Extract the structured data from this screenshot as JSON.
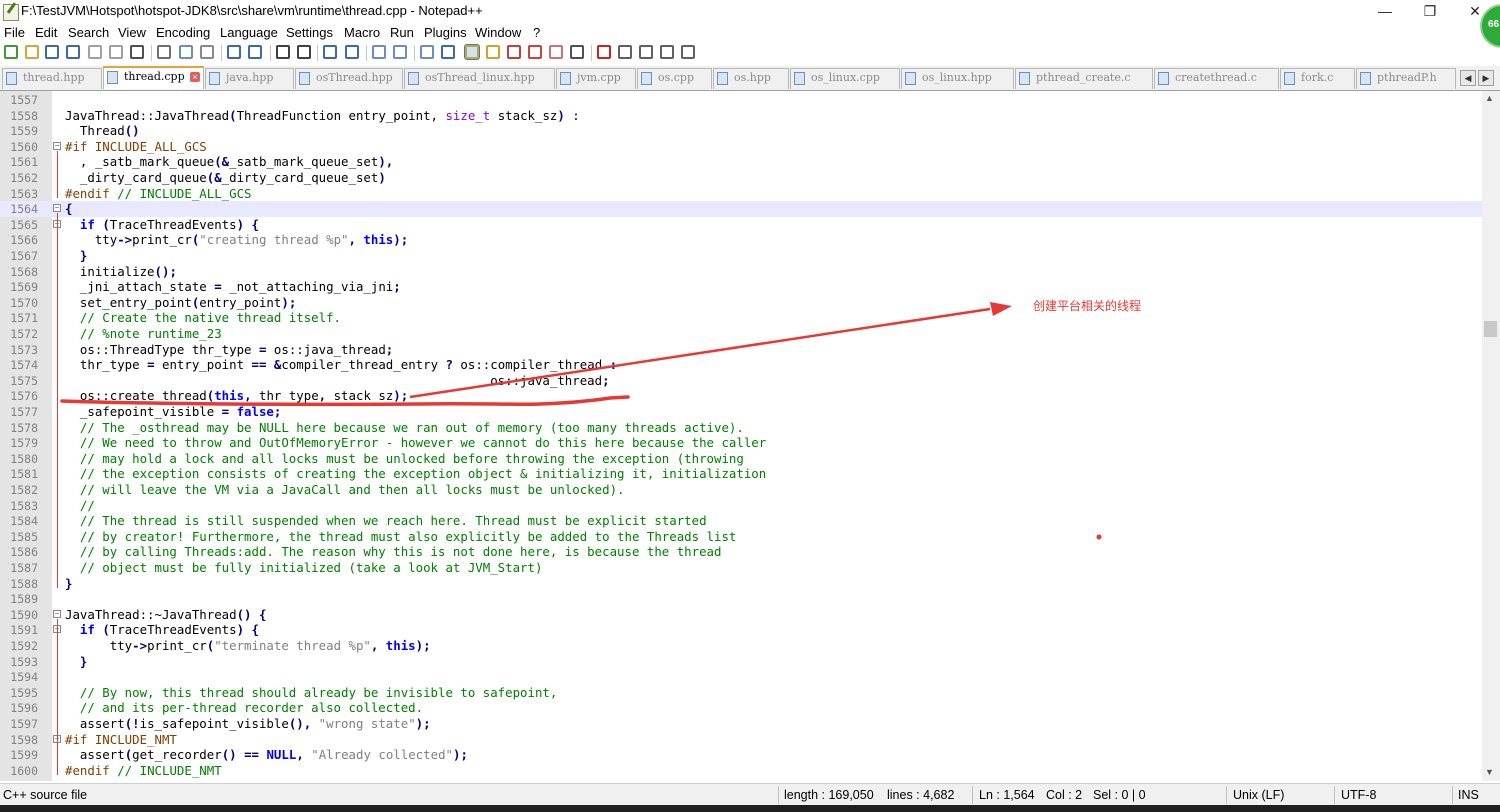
{
  "window": {
    "title": "F:\\TestJVM\\Hotspot\\hotspot-JDK8\\src\\share\\vm\\runtime\\thread.cpp - Notepad++",
    "badge": "66",
    "controls": {
      "minimize": "—",
      "maximize": "❐",
      "close": "✕"
    }
  },
  "menu": [
    "File",
    "Edit",
    "Search",
    "View",
    "Encoding",
    "Language",
    "Settings",
    "Macro",
    "Run",
    "Plugins",
    "Window",
    "?"
  ],
  "toolbar_icons": [
    "new-file-icon",
    "open-file-icon",
    "save-icon",
    "save-all-icon",
    "close-icon",
    "close-all-icon",
    "print-icon",
    "cut-icon",
    "copy-icon",
    "paste-icon",
    "undo-icon",
    "redo-icon",
    "find-icon",
    "replace-icon",
    "zoom-in-icon",
    "zoom-out-icon",
    "sync-v-icon",
    "sync-h-icon",
    "wrap-icon",
    "show-all-chars-icon",
    "indent-guide-icon",
    "udl-icon",
    "doc-map-icon",
    "function-list-icon",
    "folder-workspace-icon",
    "monitor-icon",
    "record-macro-icon",
    "stop-record-icon",
    "play-macro-icon",
    "run-macro-multiple-icon",
    "save-macro-icon"
  ],
  "tabs": [
    {
      "label": "thread.hpp"
    },
    {
      "label": "thread.cpp"
    },
    {
      "label": "java.hpp"
    },
    {
      "label": "osThread.hpp"
    },
    {
      "label": "osThread_linux.hpp"
    },
    {
      "label": "jvm.cpp"
    },
    {
      "label": "os.cpp"
    },
    {
      "label": "os.hpp"
    },
    {
      "label": "os_linux.cpp"
    },
    {
      "label": "os_linux.hpp"
    },
    {
      "label": "pthread_create.c"
    },
    {
      "label": "createthread.c"
    },
    {
      "label": "fork.c"
    },
    {
      "label": "pthreadP.h"
    }
  ],
  "active_tab": "thread.cpp",
  "editor": {
    "current_line": "1564",
    "lines": [
      {
        "n": "1557",
        "segs": []
      },
      {
        "n": "1558",
        "segs": [
          [
            "",
            "JavaThread::JavaThread"
          ],
          [
            "op",
            "("
          ],
          [
            "",
            "ThreadFunction entry_point, "
          ],
          [
            "ty",
            "size_t"
          ],
          [
            "",
            " stack_sz"
          ],
          [
            "op",
            ")"
          ],
          [
            "",
            " :"
          ]
        ]
      },
      {
        "n": "1559",
        "segs": [
          [
            "",
            "  Thread"
          ],
          [
            "op",
            "()"
          ]
        ]
      },
      {
        "n": "1560",
        "fold": "-",
        "segs": [
          [
            "pp",
            "#if INCLUDE_ALL_GCS"
          ]
        ]
      },
      {
        "n": "1561",
        "segs": [
          [
            "",
            "  , _satb_mark_queue"
          ],
          [
            "op",
            "(&"
          ],
          [
            "",
            "_satb_mark_queue_set"
          ],
          [
            "op",
            "),"
          ]
        ]
      },
      {
        "n": "1562",
        "segs": [
          [
            "",
            "  _dirty_card_queue"
          ],
          [
            "op",
            "(&"
          ],
          [
            "",
            "_dirty_card_queue_set"
          ],
          [
            "op",
            ")"
          ]
        ]
      },
      {
        "n": "1563",
        "segs": [
          [
            "pp",
            "#endif"
          ],
          [
            "cm",
            " // INCLUDE_ALL_GCS"
          ]
        ]
      },
      {
        "n": "1564",
        "fold": "-",
        "segs": [
          [
            "op",
            "{"
          ]
        ]
      },
      {
        "n": "1565",
        "fold": "-",
        "segs": [
          [
            "",
            "  "
          ],
          [
            "kw",
            "if"
          ],
          [
            "",
            " "
          ],
          [
            "op",
            "("
          ],
          [
            "",
            "TraceThreadEvents"
          ],
          [
            "op",
            ")"
          ],
          [
            "",
            " "
          ],
          [
            "op",
            "{"
          ]
        ]
      },
      {
        "n": "1566",
        "segs": [
          [
            "",
            "    tty"
          ],
          [
            "op",
            "->"
          ],
          [
            "",
            "print_cr"
          ],
          [
            "op",
            "("
          ],
          [
            "st",
            "\"creating thread %p\""
          ],
          [
            "op",
            ", "
          ],
          [
            "kw",
            "this"
          ],
          [
            "op",
            ");"
          ]
        ]
      },
      {
        "n": "1567",
        "segs": [
          [
            "",
            "  "
          ],
          [
            "op",
            "}"
          ]
        ]
      },
      {
        "n": "1568",
        "segs": [
          [
            "",
            "  initialize"
          ],
          [
            "op",
            "();"
          ]
        ]
      },
      {
        "n": "1569",
        "segs": [
          [
            "",
            "  _jni_attach_state "
          ],
          [
            "op",
            "="
          ],
          [
            "",
            " _not_attaching_via_jni"
          ],
          [
            "op",
            ";"
          ]
        ]
      },
      {
        "n": "1570",
        "segs": [
          [
            "",
            "  set_entry_point"
          ],
          [
            "op",
            "("
          ],
          [
            "",
            "entry_point"
          ],
          [
            "op",
            ");"
          ]
        ]
      },
      {
        "n": "1571",
        "segs": [
          [
            "cm",
            "  // Create the native thread itself."
          ]
        ]
      },
      {
        "n": "1572",
        "segs": [
          [
            "cm",
            "  // %note runtime_23"
          ]
        ]
      },
      {
        "n": "1573",
        "segs": [
          [
            "",
            "  os::ThreadType thr_type "
          ],
          [
            "op",
            "="
          ],
          [
            "",
            " os::java_thread"
          ],
          [
            "op",
            ";"
          ]
        ]
      },
      {
        "n": "1574",
        "segs": [
          [
            "",
            "  thr_type "
          ],
          [
            "op",
            "="
          ],
          [
            "",
            " entry_point "
          ],
          [
            "op",
            "=="
          ],
          [
            "",
            " "
          ],
          [
            "op",
            "&"
          ],
          [
            "",
            "compiler_thread_entry "
          ],
          [
            "op",
            "?"
          ],
          [
            "",
            " os::compiler_thread "
          ],
          [
            "op",
            ":"
          ]
        ]
      },
      {
        "n": "1575",
        "segs": [
          [
            "",
            "                                                         os::java_thread"
          ],
          [
            "op",
            ";"
          ]
        ]
      },
      {
        "n": "1576",
        "segs": [
          [
            "",
            "  os::create_thread"
          ],
          [
            "op",
            "("
          ],
          [
            "kw",
            "this"
          ],
          [
            "op",
            ","
          ],
          [
            "",
            " thr_type"
          ],
          [
            "op",
            ","
          ],
          [
            "",
            " stack_sz"
          ],
          [
            "op",
            ");"
          ]
        ]
      },
      {
        "n": "1577",
        "segs": [
          [
            "",
            "  _safepoint_visible "
          ],
          [
            "op",
            "="
          ],
          [
            "",
            " "
          ],
          [
            "kw",
            "false"
          ],
          [
            "op",
            ";"
          ]
        ]
      },
      {
        "n": "1578",
        "segs": [
          [
            "cm",
            "  // The _osthread may be NULL here because we ran out of memory (too many threads active)."
          ]
        ]
      },
      {
        "n": "1579",
        "segs": [
          [
            "cm",
            "  // We need to throw and OutOfMemoryError - however we cannot do this here because the caller"
          ]
        ]
      },
      {
        "n": "1580",
        "segs": [
          [
            "cm",
            "  // may hold a lock and all locks must be unlocked before throwing the exception (throwing"
          ]
        ]
      },
      {
        "n": "1581",
        "segs": [
          [
            "cm",
            "  // the exception consists of creating the exception object & initializing it, initialization"
          ]
        ]
      },
      {
        "n": "1582",
        "segs": [
          [
            "cm",
            "  // will leave the VM via a JavaCall and then all locks must be unlocked)."
          ]
        ]
      },
      {
        "n": "1583",
        "segs": [
          [
            "cm",
            "  //"
          ]
        ]
      },
      {
        "n": "1584",
        "segs": [
          [
            "cm",
            "  // The thread is still suspended when we reach here. Thread must be explicit started"
          ]
        ]
      },
      {
        "n": "1585",
        "segs": [
          [
            "cm",
            "  // by creator! Furthermore, the thread must also explicitly be added to the Threads list"
          ]
        ]
      },
      {
        "n": "1586",
        "segs": [
          [
            "cm",
            "  // by calling Threads:add. The reason why this is not done here, is because the thread"
          ]
        ]
      },
      {
        "n": "1587",
        "segs": [
          [
            "cm",
            "  // object must be fully initialized (take a look at JVM_Start)"
          ]
        ]
      },
      {
        "n": "1588",
        "segs": [
          [
            "op",
            "}"
          ]
        ]
      },
      {
        "n": "1589",
        "segs": []
      },
      {
        "n": "1590",
        "fold": "-",
        "segs": [
          [
            "",
            "JavaThread::~JavaThread"
          ],
          [
            "op",
            "()"
          ],
          [
            "",
            " "
          ],
          [
            "op",
            "{"
          ]
        ]
      },
      {
        "n": "1591",
        "fold": "-",
        "segs": [
          [
            "",
            "  "
          ],
          [
            "kw",
            "if"
          ],
          [
            "",
            " "
          ],
          [
            "op",
            "("
          ],
          [
            "",
            "TraceThreadEvents"
          ],
          [
            "op",
            ")"
          ],
          [
            "",
            " "
          ],
          [
            "op",
            "{"
          ]
        ]
      },
      {
        "n": "1592",
        "segs": [
          [
            "",
            "      tty"
          ],
          [
            "op",
            "->"
          ],
          [
            "",
            "print_cr"
          ],
          [
            "op",
            "("
          ],
          [
            "st",
            "\"terminate thread %p\""
          ],
          [
            "op",
            ", "
          ],
          [
            "kw",
            "this"
          ],
          [
            "op",
            ");"
          ]
        ]
      },
      {
        "n": "1593",
        "segs": [
          [
            "",
            "  "
          ],
          [
            "op",
            "}"
          ]
        ]
      },
      {
        "n": "1594",
        "segs": []
      },
      {
        "n": "1595",
        "segs": [
          [
            "cm",
            "  // By now, this thread should already be invisible to safepoint,"
          ]
        ]
      },
      {
        "n": "1596",
        "segs": [
          [
            "cm",
            "  // and its per-thread recorder also collected."
          ]
        ]
      },
      {
        "n": "1597",
        "segs": [
          [
            "",
            "  assert"
          ],
          [
            "op",
            "(!"
          ],
          [
            "",
            "is_safepoint_visible"
          ],
          [
            "op",
            "(),"
          ],
          [
            "",
            " "
          ],
          [
            "st",
            "\"wrong state\""
          ],
          [
            "op",
            ");"
          ]
        ]
      },
      {
        "n": "1598",
        "fold": "-",
        "segs": [
          [
            "pp",
            "#if INCLUDE_NMT"
          ]
        ]
      },
      {
        "n": "1599",
        "segs": [
          [
            "",
            "  assert"
          ],
          [
            "op",
            "("
          ],
          [
            "",
            "get_recorder"
          ],
          [
            "op",
            "()"
          ],
          [
            "",
            " "
          ],
          [
            "op",
            "=="
          ],
          [
            "",
            " "
          ],
          [
            "kw",
            "NULL"
          ],
          [
            "op",
            ","
          ],
          [
            "",
            " "
          ],
          [
            "st",
            "\"Already collected\""
          ],
          [
            "op",
            ");"
          ]
        ]
      },
      {
        "n": "1600",
        "segs": [
          [
            "pp",
            "#endif"
          ],
          [
            "cm",
            " // INCLUDE_NMT"
          ]
        ]
      }
    ]
  },
  "annotation": {
    "text": "创建平台相关的线程",
    "color": "#e53935"
  },
  "status": {
    "file_type": "C++ source file",
    "length": "length : 169,050",
    "lines": "lines : 4,682",
    "ln": "Ln : 1,564",
    "col": "Col : 2",
    "sel": "Sel : 0 | 0",
    "eol": "Unix (LF)",
    "encoding": "UTF-8",
    "mode": "INS"
  }
}
